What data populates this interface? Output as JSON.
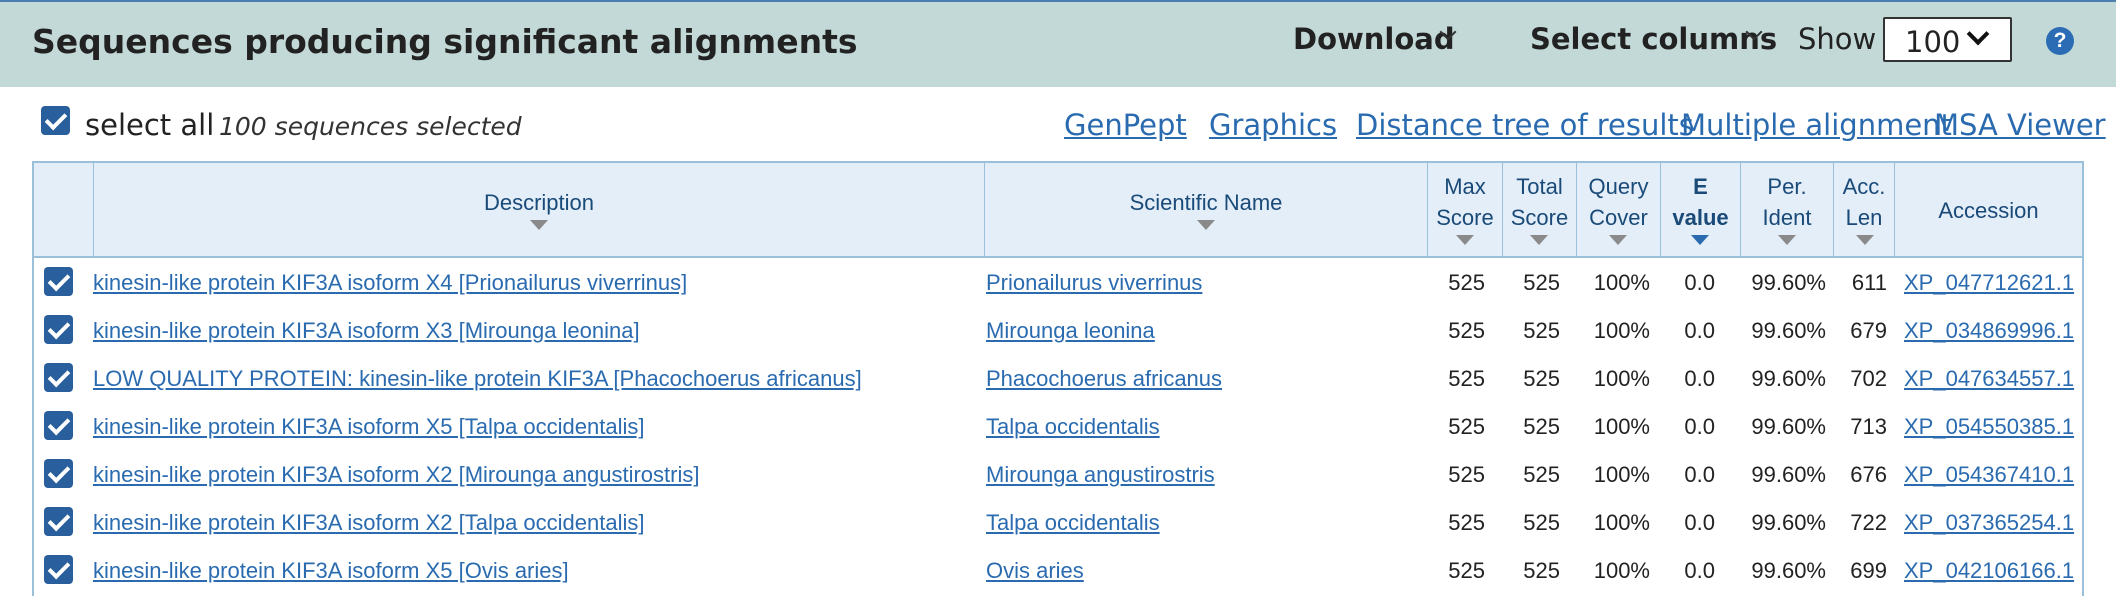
{
  "header": {
    "title": "Sequences producing significant alignments",
    "download_label": "Download",
    "select_columns_label": "Select columns",
    "show_label": "Show",
    "show_value": "100",
    "help_symbol": "?"
  },
  "toolbar": {
    "select_all_label": "select all",
    "selected_count_text": "100 sequences selected",
    "links": [
      "GenPept",
      "Graphics",
      "Distance tree of results",
      "Multiple alignment",
      "MSA Viewer"
    ]
  },
  "table": {
    "columns": {
      "description": "Description",
      "scientific_name": "Scientific Name",
      "max_score_1": "Max",
      "max_score_2": "Score",
      "total_score_1": "Total",
      "total_score_2": "Score",
      "query_cover_1": "Query",
      "query_cover_2": "Cover",
      "e_value_1": "E",
      "e_value_2": "value",
      "per_ident_1": "Per.",
      "per_ident_2": "Ident",
      "acc_len_1": "Acc.",
      "acc_len_2": "Len",
      "accession": "Accession"
    },
    "rows": [
      {
        "description": "kinesin-like protein KIF3A isoform X4 [Prionailurus viverrinus]",
        "scientific_name": "Prionailurus viverrinus",
        "max_score": "525",
        "total_score": "525",
        "query_cover": "100%",
        "e_value": "0.0",
        "per_ident": "99.60%",
        "acc_len": "611",
        "accession": "XP_047712621.1"
      },
      {
        "description": "kinesin-like protein KIF3A isoform X3 [Mirounga leonina]",
        "scientific_name": "Mirounga leonina",
        "max_score": "525",
        "total_score": "525",
        "query_cover": "100%",
        "e_value": "0.0",
        "per_ident": "99.60%",
        "acc_len": "679",
        "accession": "XP_034869996.1"
      },
      {
        "description": "LOW QUALITY PROTEIN: kinesin-like protein KIF3A [Phacochoerus africanus]",
        "scientific_name": "Phacochoerus africanus",
        "max_score": "525",
        "total_score": "525",
        "query_cover": "100%",
        "e_value": "0.0",
        "per_ident": "99.60%",
        "acc_len": "702",
        "accession": "XP_047634557.1"
      },
      {
        "description": "kinesin-like protein KIF3A isoform X5 [Talpa occidentalis]",
        "scientific_name": "Talpa occidentalis",
        "max_score": "525",
        "total_score": "525",
        "query_cover": "100%",
        "e_value": "0.0",
        "per_ident": "99.60%",
        "acc_len": "713",
        "accession": "XP_054550385.1"
      },
      {
        "description": "kinesin-like protein KIF3A isoform X2 [Mirounga angustirostris]",
        "scientific_name": "Mirounga angustirostris",
        "max_score": "525",
        "total_score": "525",
        "query_cover": "100%",
        "e_value": "0.0",
        "per_ident": "99.60%",
        "acc_len": "676",
        "accession": "XP_054367410.1"
      },
      {
        "description": "kinesin-like protein KIF3A isoform X2 [Talpa occidentalis]",
        "scientific_name": "Talpa occidentalis",
        "max_score": "525",
        "total_score": "525",
        "query_cover": "100%",
        "e_value": "0.0",
        "per_ident": "99.60%",
        "acc_len": "722",
        "accession": "XP_037365254.1"
      },
      {
        "description": "kinesin-like protein KIF3A isoform X5 [Ovis aries]",
        "scientific_name": "Ovis aries",
        "max_score": "525",
        "total_score": "525",
        "query_cover": "100%",
        "e_value": "0.0",
        "per_ident": "99.60%",
        "acc_len": "699",
        "accession": "XP_042106166.1"
      }
    ]
  },
  "colors": {
    "header_bg": "#c3d9d8",
    "link": "#2a6bb0",
    "checkbox": "#2a5f9e",
    "table_header_bg": "#e3eef8",
    "table_border": "#9bc0da"
  },
  "icons": {
    "checkbox": "checkbox-checked-icon",
    "dropdown": "chevron-down-icon",
    "help": "help-icon",
    "sort": "sort-triangle-icon"
  }
}
